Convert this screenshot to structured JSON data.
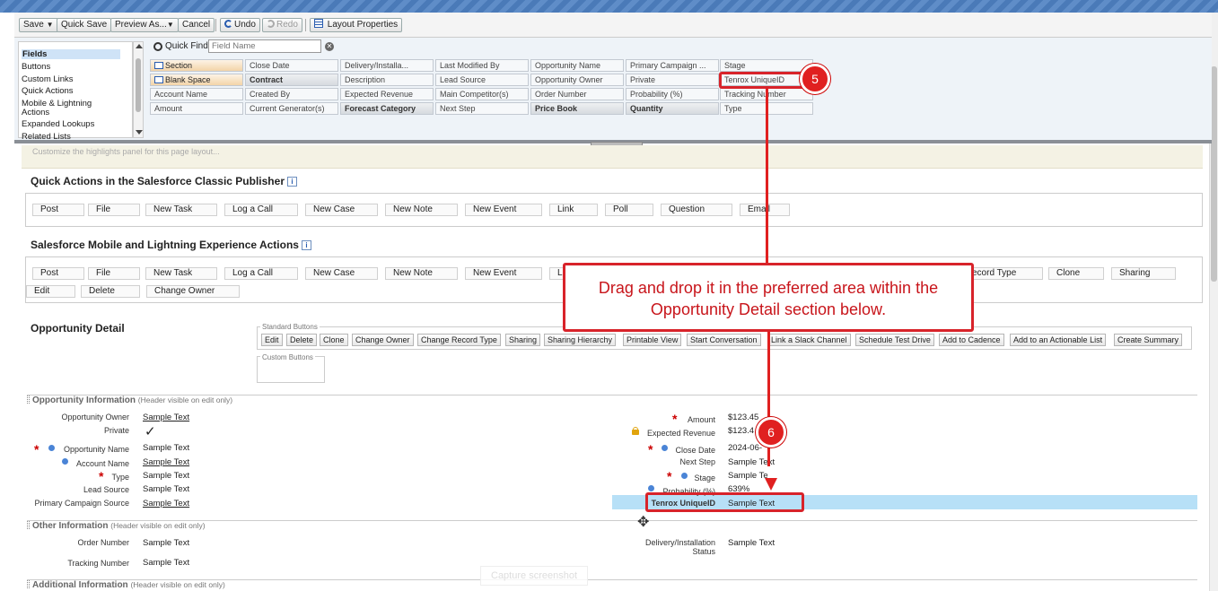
{
  "toolbar": {
    "save": "Save",
    "quick_save": "Quick Save",
    "preview_as": "Preview As...",
    "cancel": "Cancel",
    "undo": "Undo",
    "redo": "Redo",
    "layout_properties": "Layout Properties"
  },
  "palette": {
    "categories": [
      "Fields",
      "Buttons",
      "Custom Links",
      "Quick Actions",
      "Mobile & Lightning",
      "Actions",
      "Expanded Lookups",
      "Related Lists"
    ],
    "quick_find_label": "Quick Find",
    "quick_find_placeholder": "Field Name",
    "fields": [
      [
        "Section",
        "Close Date",
        "Delivery/Installa...",
        "Last Modified By",
        "Opportunity Name",
        "Primary Campaign ...",
        "Stage"
      ],
      [
        "Blank Space",
        "Contract",
        "Description",
        "Lead Source",
        "Opportunity Owner",
        "Private",
        "Tenrox UniqueID"
      ],
      [
        "Account Name",
        "Created By",
        "Expected Revenue",
        "Main Competitor(s)",
        "Order Number",
        "Probability (%)",
        "Tracking Number"
      ],
      [
        "Amount",
        "Current Generator(s)",
        "Forecast Category",
        "Next Step",
        "Price Book",
        "Quantity",
        "Type"
      ]
    ]
  },
  "hint_text": "Customize the highlights panel for this page layout...",
  "quick_actions_classic": {
    "title": "Quick Actions in the Salesforce Classic Publisher",
    "info": "i",
    "buttons": [
      "Post",
      "File",
      "New Task",
      "Log a Call",
      "New Case",
      "New Note",
      "New Event",
      "Link",
      "Poll",
      "Question",
      "Email"
    ]
  },
  "mobile_actions": {
    "title": "Salesforce Mobile and Lightning Experience Actions",
    "info": "i",
    "row1": [
      "Post",
      "File",
      "New Task",
      "Log a Call",
      "New Case",
      "New Note",
      "New Event",
      "L",
      "ecord Type",
      "Clone",
      "Sharing"
    ],
    "row2": [
      "Edit",
      "Delete",
      "Change Owner"
    ]
  },
  "opportunity_detail": {
    "title": "Opportunity Detail",
    "standard_buttons_label": "Standard Buttons",
    "custom_buttons_label": "Custom Buttons",
    "standard_buttons": [
      "Edit",
      "Delete",
      "Clone",
      "Change Owner",
      "Change Record Type",
      "Sharing",
      "Sharing Hierarchy",
      "Printable View",
      "Start Conversation",
      "Link a Slack Channel",
      "Schedule Test Drive",
      "Add to Cadence",
      "Add to an Actionable List",
      "Create Summary"
    ]
  },
  "sections": {
    "opportunity_info": "Opportunity Information",
    "other_info": "Other Information",
    "additional_info": "Additional Information",
    "header_note": "(Header visible on edit only)"
  },
  "fields_left": [
    {
      "label": "Opportunity Owner",
      "value": "Sample Text"
    },
    {
      "label": "Private",
      "value": "✓"
    },
    {
      "label": "Opportunity Name",
      "value": "Sample Text"
    },
    {
      "label": "Account Name",
      "value": "Sample Text"
    },
    {
      "label": "Type",
      "value": "Sample Text"
    },
    {
      "label": "Lead Source",
      "value": "Sample Text"
    },
    {
      "label": "Primary Campaign Source",
      "value": "Sample Text"
    }
  ],
  "fields_right": [
    {
      "label": "Amount",
      "value": "$123.45"
    },
    {
      "label": "Expected Revenue",
      "value": "$123.4"
    },
    {
      "label": "Close Date",
      "value": "2024-06-"
    },
    {
      "label": "Next Step",
      "value": "Sample Text"
    },
    {
      "label": "Stage",
      "value": "Sample Te"
    },
    {
      "label": "Probability (%)",
      "value": "639%"
    },
    {
      "label": "Tenrox UniqueID",
      "value": "Sample Text"
    }
  ],
  "other_fields": [
    {
      "label": "Order Number",
      "value": "Sample Text"
    },
    {
      "label": "Tracking Number",
      "value": "Sample Text"
    },
    {
      "label": "Delivery/Installation Status",
      "value": "Sample Text"
    }
  ],
  "annotations": {
    "step5": "5",
    "step6": "6",
    "callout": "Drag and drop it in the preferred area within the Opportunity Detail section below.",
    "capture": "Capture screenshot"
  },
  "colors": {
    "callout_red": "#d8232a",
    "highlight_row": "#b7e0f7",
    "required_red": "#cc0000"
  }
}
